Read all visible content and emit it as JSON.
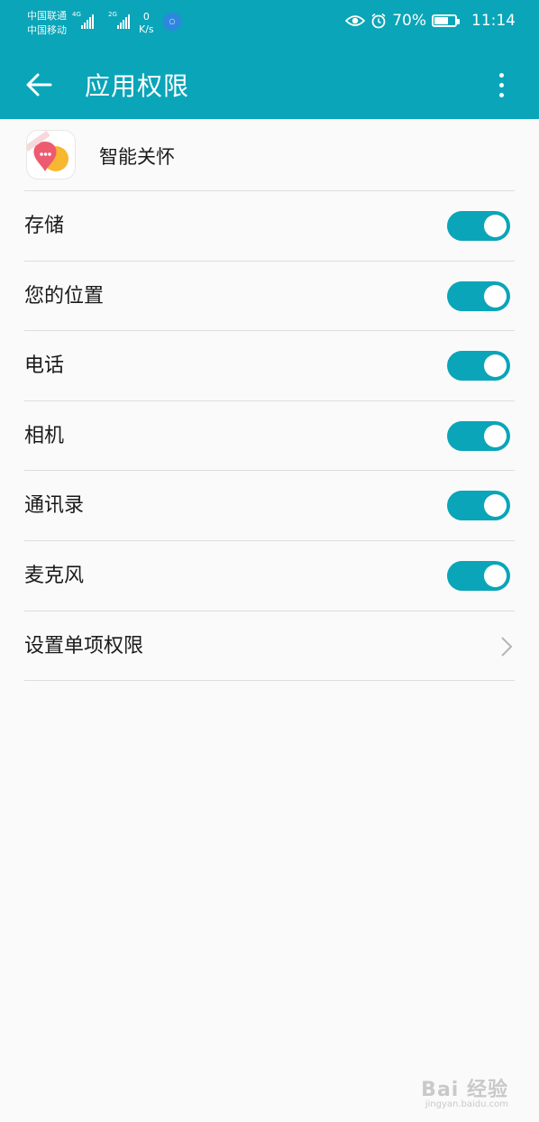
{
  "status_bar": {
    "carrier_1": "中国联通",
    "carrier_2": "中国移动",
    "net_1": "4G",
    "net_2": "2G",
    "speed_value": "0",
    "speed_unit": "K/s",
    "battery_text": "70%",
    "battery_level": 0.7,
    "time": "11:14"
  },
  "toolbar": {
    "title": "应用权限"
  },
  "app": {
    "name": "智能关怀"
  },
  "permissions": [
    {
      "label": "存储",
      "enabled": true
    },
    {
      "label": "您的位置",
      "enabled": true
    },
    {
      "label": "电话",
      "enabled": true
    },
    {
      "label": "相机",
      "enabled": true
    },
    {
      "label": "通讯录",
      "enabled": true
    },
    {
      "label": "麦克风",
      "enabled": true
    }
  ],
  "individual": {
    "label": "设置单项权限"
  },
  "watermark": {
    "brand": "Bai 经验",
    "url": "jingyan.baidu.com"
  },
  "colors": {
    "accent": "#0aa5b8",
    "background": "#fafafa"
  }
}
